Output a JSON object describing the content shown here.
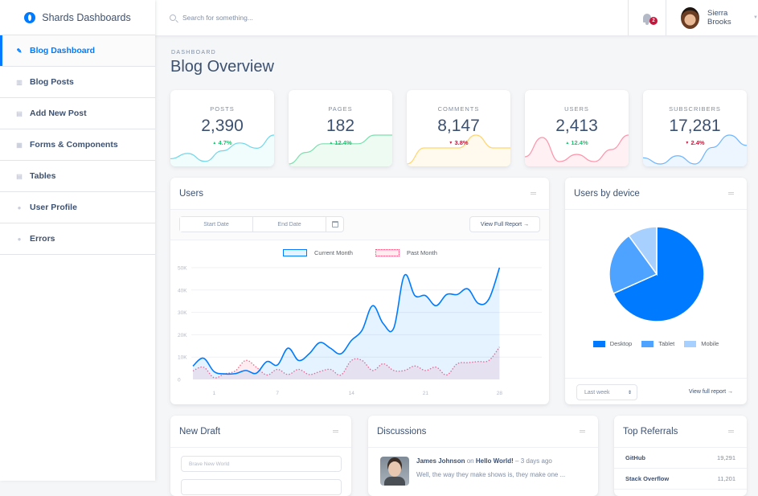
{
  "brand": {
    "name": "Shards Dashboards"
  },
  "sidebar": {
    "items": [
      {
        "label": "Blog Dashboard",
        "icon": "pencil-icon",
        "active": true
      },
      {
        "label": "Blog Posts",
        "icon": "columns-icon",
        "active": false
      },
      {
        "label": "Add New Post",
        "icon": "note-add-icon",
        "active": false
      },
      {
        "label": "Forms & Components",
        "icon": "grid-icon",
        "active": false
      },
      {
        "label": "Tables",
        "icon": "table-icon",
        "active": false
      },
      {
        "label": "User Profile",
        "icon": "person-icon",
        "active": false
      },
      {
        "label": "Errors",
        "icon": "error-icon",
        "active": false
      }
    ]
  },
  "topbar": {
    "search_placeholder": "Search for something...",
    "notification_count": "2",
    "user_name": "Sierra Brooks"
  },
  "page": {
    "subtitle": "DASHBOARD",
    "title": "Blog Overview"
  },
  "stats": [
    {
      "label": "POSTS",
      "value": "2,390",
      "change": "4.7%",
      "direction": "up",
      "color": "#00b8d8",
      "fill": "#f1fcfd",
      "spark": [
        2,
        4,
        1,
        5,
        8,
        6,
        11
      ]
    },
    {
      "label": "PAGES",
      "value": "182",
      "change": "12.4%",
      "direction": "up",
      "color": "#17c671",
      "fill": "#edfbf3",
      "spark": [
        0,
        4,
        7,
        7,
        7,
        10,
        10
      ]
    },
    {
      "label": "COMMENTS",
      "value": "8,147",
      "change": "3.8%",
      "direction": "down",
      "color": "#ffb400",
      "fill": "#fffaed",
      "spark": [
        0,
        5,
        5,
        5,
        9,
        5,
        5
      ]
    },
    {
      "label": "USERS",
      "value": "2,413",
      "change": "12.4%",
      "direction": "up",
      "color": "#ff4169",
      "fill": "#fff0f3",
      "spark": [
        3,
        11,
        1,
        4,
        1,
        6,
        12
      ]
    },
    {
      "label": "SUBSCRIBERS",
      "value": "17,281",
      "change": "2.4%",
      "direction": "down",
      "color": "#007bff",
      "fill": "#edf5ff",
      "spark": [
        3,
        0,
        4,
        0,
        8,
        14,
        9
      ]
    }
  ],
  "users_card": {
    "title": "Users",
    "start_date_placeholder": "Start Date",
    "end_date_placeholder": "End Date",
    "report_button": "View Full Report →"
  },
  "device_card": {
    "title": "Users by device",
    "range_select": "Last week",
    "report_link": "View full report →"
  },
  "draft_card": {
    "title": "New Draft",
    "title_placeholder": "Brave New World"
  },
  "discussions_card": {
    "title": "Discussions",
    "items": [
      {
        "author": "James Johnson",
        "on_word": "on",
        "post": "Hello World!",
        "time": "– 3 days ago",
        "excerpt": "Well, the way they make shows is, they make one ..."
      }
    ]
  },
  "referrals_card": {
    "title": "Top Referrals",
    "items": [
      {
        "name": "GitHub",
        "value": "19,291"
      },
      {
        "name": "Stack Overflow",
        "value": "11,201"
      }
    ]
  },
  "chart_data": [
    {
      "type": "line",
      "title": "Users",
      "x_ticks": [
        "1",
        "7",
        "14",
        "21",
        "28"
      ],
      "x_tick_days": [
        1,
        7,
        14,
        21,
        28
      ],
      "x_range_days": [
        -1,
        32
      ],
      "y_ticks": [
        "0",
        "10K",
        "20K",
        "30K",
        "40K",
        "50K"
      ],
      "ylim": [
        0,
        50000
      ],
      "grid": true,
      "legend_position": "top-center",
      "series": [
        {
          "name": "Current Month",
          "color": "#007bff",
          "fill": "rgba(0,123,255,0.1)",
          "style": "solid",
          "days": [
            -1,
            0,
            1,
            2,
            3,
            4,
            5,
            6,
            7,
            8,
            9,
            10,
            11,
            12,
            13,
            14,
            15,
            16,
            17,
            18,
            19,
            20,
            21,
            22,
            23,
            24,
            25,
            26,
            27,
            28,
            29,
            30,
            31,
            32
          ],
          "values": [
            6000,
            9500,
            3500,
            2500,
            2600,
            4000,
            2800,
            8000,
            6500,
            14000,
            8500,
            11500,
            16500,
            14000,
            11500,
            17500,
            22000,
            33000,
            25000,
            23000,
            46500,
            37500,
            37500,
            33000,
            38000,
            38000,
            40500,
            34000,
            36000,
            50000,
            null,
            null,
            null,
            null
          ]
        },
        {
          "name": "Past Month",
          "color": "#ff4169",
          "fill": "rgba(255,65,105,0.1)",
          "style": "dotted",
          "days": [
            -1,
            0,
            1,
            2,
            3,
            4,
            5,
            6,
            7,
            8,
            9,
            10,
            11,
            12,
            13,
            14,
            15,
            16,
            17,
            18,
            19,
            20,
            21,
            22,
            23,
            24,
            25,
            26,
            27,
            28,
            29,
            30,
            31,
            32
          ],
          "values": [
            3800,
            5500,
            800,
            2500,
            3800,
            8500,
            5500,
            2000,
            4500,
            2200,
            4500,
            2200,
            3500,
            4500,
            2000,
            8500,
            8500,
            4000,
            7000,
            4000,
            4000,
            6000,
            4000,
            5500,
            2000,
            7000,
            7500,
            8000,
            8500,
            14500,
            null,
            null,
            null,
            null
          ]
        }
      ]
    },
    {
      "type": "pie",
      "title": "Users by device",
      "legend_position": "bottom",
      "slices": [
        {
          "label": "Desktop",
          "value": 68.3,
          "color": "#007bff"
        },
        {
          "label": "Tablet",
          "value": 21.7,
          "color": "#4da3ff"
        },
        {
          "label": "Mobile",
          "value": 10.0,
          "color": "#a8d0ff"
        }
      ]
    }
  ]
}
